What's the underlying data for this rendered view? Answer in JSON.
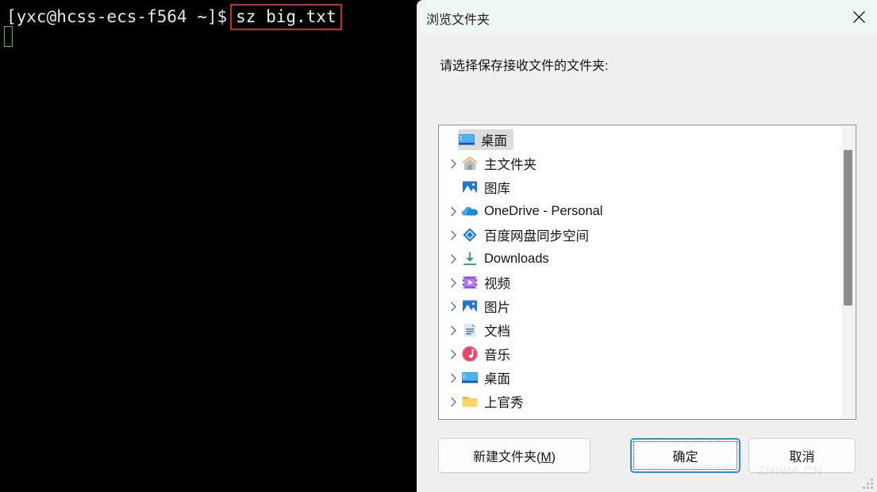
{
  "terminal": {
    "prompt": "[yxc@hcss-ecs-f564 ~]$",
    "command": "sz big.txt",
    "highlight_color": "#c92c2c",
    "cursor_color": "#2ecc40",
    "background": "#000000",
    "text_color": "#d8d8d8"
  },
  "dialog": {
    "title": "浏览文件夹",
    "close_icon": "close-icon",
    "prompt": "请选择保存接收文件的文件夹:",
    "watermark": "ZHIWA.CN",
    "tree": {
      "items": [
        {
          "label": "桌面",
          "icon": "desktop-icon",
          "expandable": false,
          "selected": true,
          "indent": 0
        },
        {
          "label": "主文件夹",
          "icon": "home-icon",
          "expandable": true,
          "selected": false,
          "indent": 1
        },
        {
          "label": "图库",
          "icon": "gallery-icon",
          "expandable": false,
          "selected": false,
          "indent": 1
        },
        {
          "label": "OneDrive - Personal",
          "icon": "cloud-icon",
          "expandable": true,
          "selected": false,
          "indent": 1
        },
        {
          "label": "百度网盘同步空间",
          "icon": "baidu-netdisk-icon",
          "expandable": true,
          "selected": false,
          "indent": 1
        },
        {
          "label": "Downloads",
          "icon": "download-icon",
          "expandable": true,
          "selected": false,
          "indent": 1
        },
        {
          "label": "视频",
          "icon": "video-icon",
          "expandable": true,
          "selected": false,
          "indent": 1
        },
        {
          "label": "图片",
          "icon": "pictures-icon",
          "expandable": true,
          "selected": false,
          "indent": 1
        },
        {
          "label": "文档",
          "icon": "documents-icon",
          "expandable": true,
          "selected": false,
          "indent": 1
        },
        {
          "label": "音乐",
          "icon": "music-icon",
          "expandable": true,
          "selected": false,
          "indent": 1
        },
        {
          "label": "桌面",
          "icon": "desktop-icon",
          "expandable": true,
          "selected": false,
          "indent": 1
        },
        {
          "label": "上官秀",
          "icon": "folder-icon",
          "expandable": true,
          "selected": false,
          "indent": 1
        }
      ],
      "scrollbar": {
        "thumb_top_pct": 8,
        "thumb_height_pct": 53
      }
    },
    "buttons": {
      "new_folder": "新建文件夹(M)",
      "new_folder_mnemonic": "M",
      "ok": "确定",
      "cancel": "取消",
      "focused": "ok",
      "focus_color": "#2f8fd0"
    }
  }
}
